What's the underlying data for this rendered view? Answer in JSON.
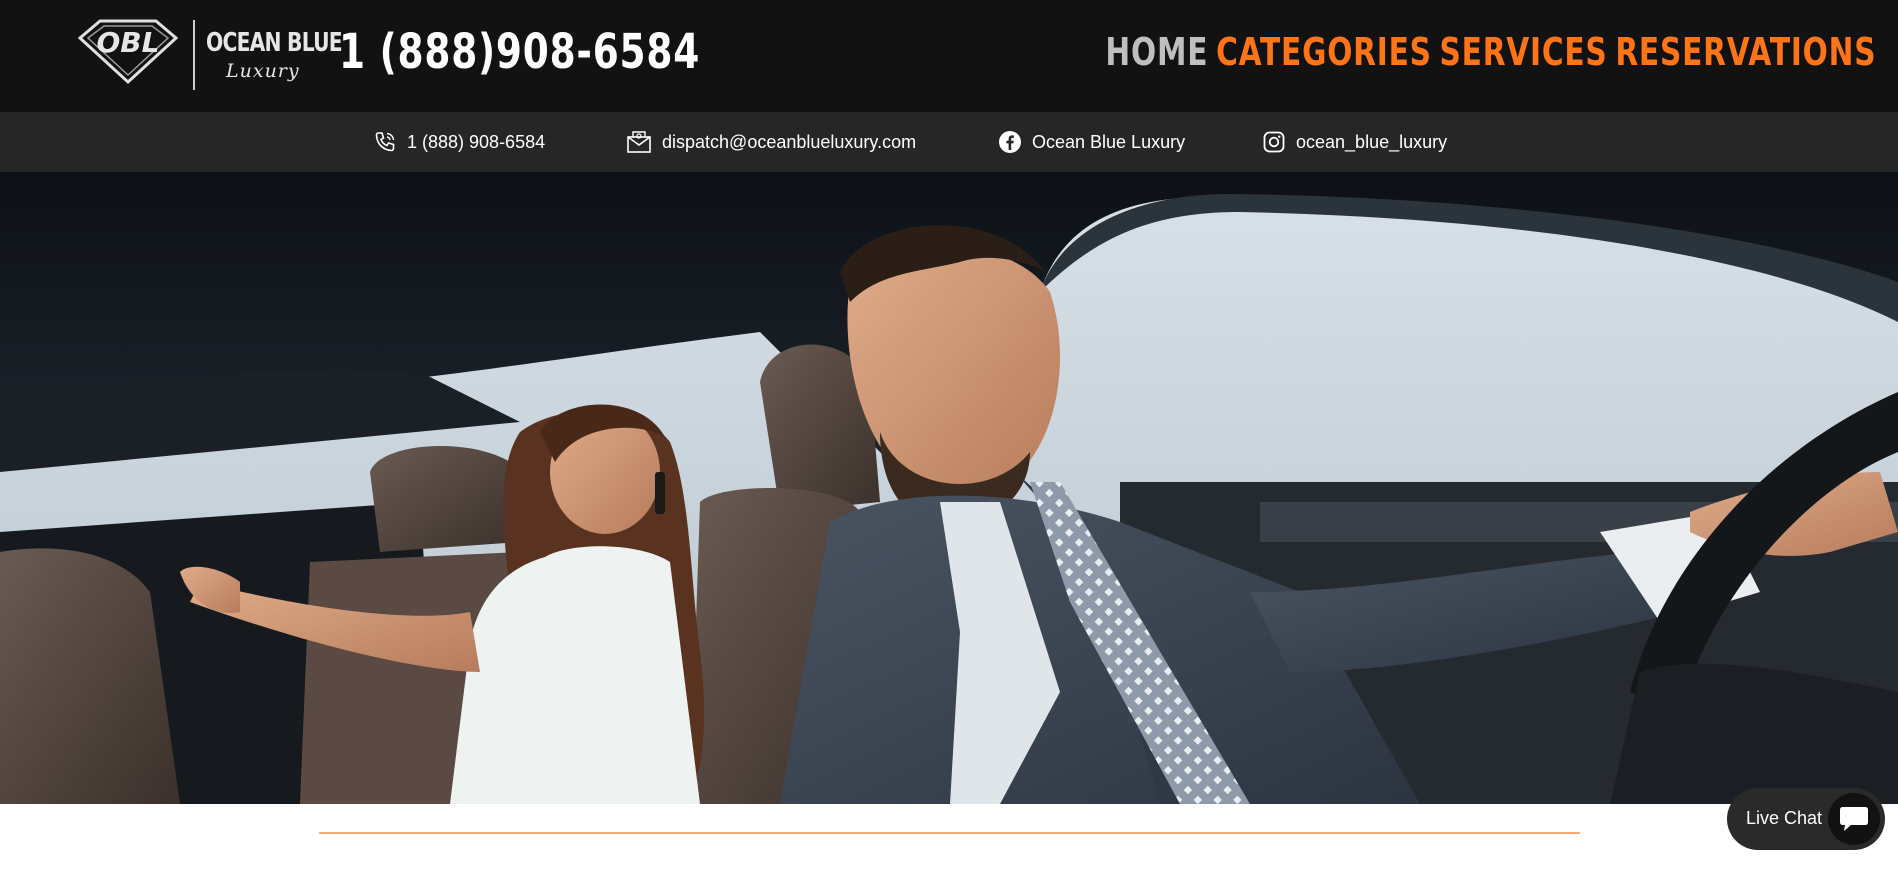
{
  "header": {
    "logo_monogram": "OBL",
    "logo_name": "OCEAN BLUE",
    "logo_tagline": "Luxury",
    "phone_display": "1 (888)908-6584"
  },
  "nav": {
    "items": [
      {
        "label": "HOME",
        "state": "active",
        "color": "#bfbfbf"
      },
      {
        "label": "CATEGORIES",
        "color": "#ff7417"
      },
      {
        "label": "SERVICES",
        "color": "#ff7417"
      },
      {
        "label": "RESERVATIONS",
        "color": "#ff7417"
      }
    ]
  },
  "infobar": {
    "phone": {
      "icon": "phone-icon",
      "text": "1 (888) 908-6584"
    },
    "email": {
      "icon": "mail-icon",
      "text": "dispatch@oceanblueluxury.com"
    },
    "facebook": {
      "icon": "facebook-icon",
      "text": "Ocean Blue Luxury"
    },
    "instagram": {
      "icon": "instagram-icon",
      "text": "ocean_blue_luxury"
    }
  },
  "hero": {
    "image_description": "chauffeur in suit driving, smiling passenger on phone in back seat"
  },
  "chat_widget": {
    "label": "Live Chat",
    "icon": "chat-bubble-icon"
  },
  "colors": {
    "header_bg": "#121212",
    "infobar_bg": "#262626",
    "accent_orange": "#ff7417",
    "divider_line": "#f7a877"
  }
}
